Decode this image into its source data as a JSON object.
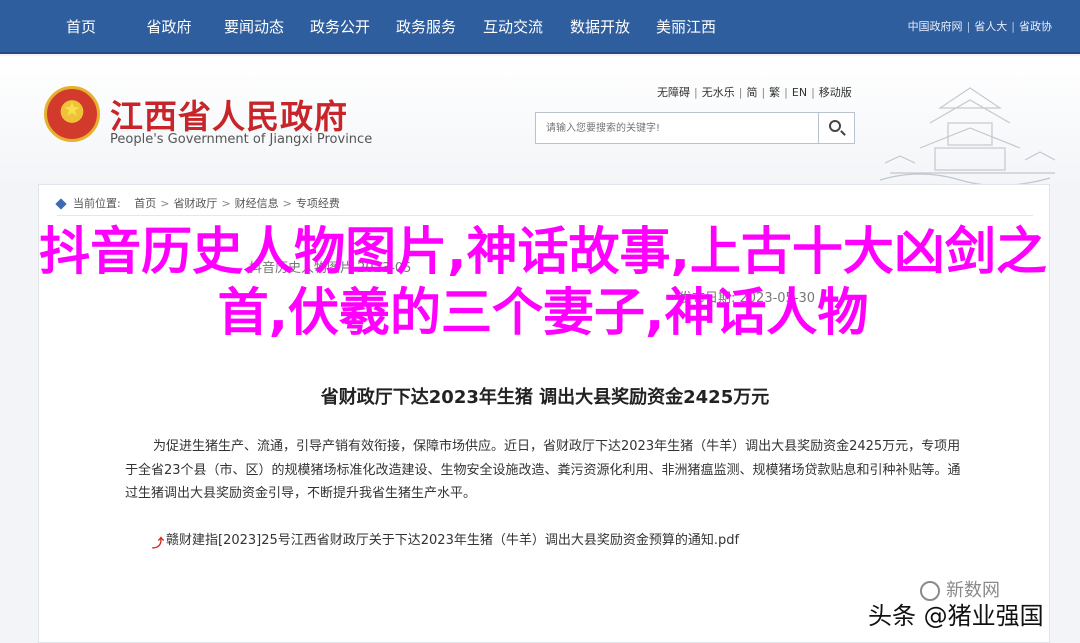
{
  "topnav": {
    "items": [
      "首页",
      "省政府",
      "要闻动态",
      "政务公开",
      "政务服务",
      "互动交流",
      "数据开放",
      "美丽江西"
    ],
    "gov_links": [
      "中国政府网",
      "省人大",
      "省政协"
    ]
  },
  "header": {
    "title": "江西省人民政府",
    "subtitle": "People's Government of Jiangxi Province",
    "util_links": [
      "无障碍",
      "无水乐",
      "简",
      "繁",
      "EN",
      "移动版"
    ],
    "search": {
      "placeholder": "请输入您要搜索的关键字!"
    }
  },
  "breadcrumb": {
    "label": "当前位置:",
    "items": [
      "首页",
      "省财政厅",
      "财经信息",
      "专项经费"
    ]
  },
  "faded": {
    "line1": "抖音历史人物图片 2023-05",
    "line2": "发布日期: 2023-05-30"
  },
  "article": {
    "title": "省财政厅下达2023年生猪（牛羊）调出大县奖励资金2425万元",
    "title_display": "省财政厅下达2023年生猪  调出大县奖励资金2425万元",
    "body": "为促进生猪生产、流通，引导产销有效衔接，保障市场供应。近日，省财政厅下达2023年生猪（牛羊）调出大县奖励资金2425万元，专项用于全省23个县（市、区）的规模猪场标准化改造建设、生物安全设施改造、粪污资源化利用、非洲猪瘟监测、规模猪场贷款贴息和引种补贴等。通过生猪调出大县奖励资金引导，不断提升我省生猪生产水平。",
    "attachment": "赣财建指[2023]25号江西省财政厅关于下达2023年生猪（牛羊）调出大县奖励资金预算的通知.pdf"
  },
  "overlay": {
    "headline": "抖音历史人物图片,神话故事,上古十大凶剑之首,伏羲的三个妻子,神话人物"
  },
  "watermarks": {
    "newdata": "新数网",
    "source": "头条 @猪业强国"
  },
  "colors": {
    "nav_bg": "#2f5e9e",
    "title_red": "#c8252a",
    "overlay_magenta": "#ff00ff"
  }
}
